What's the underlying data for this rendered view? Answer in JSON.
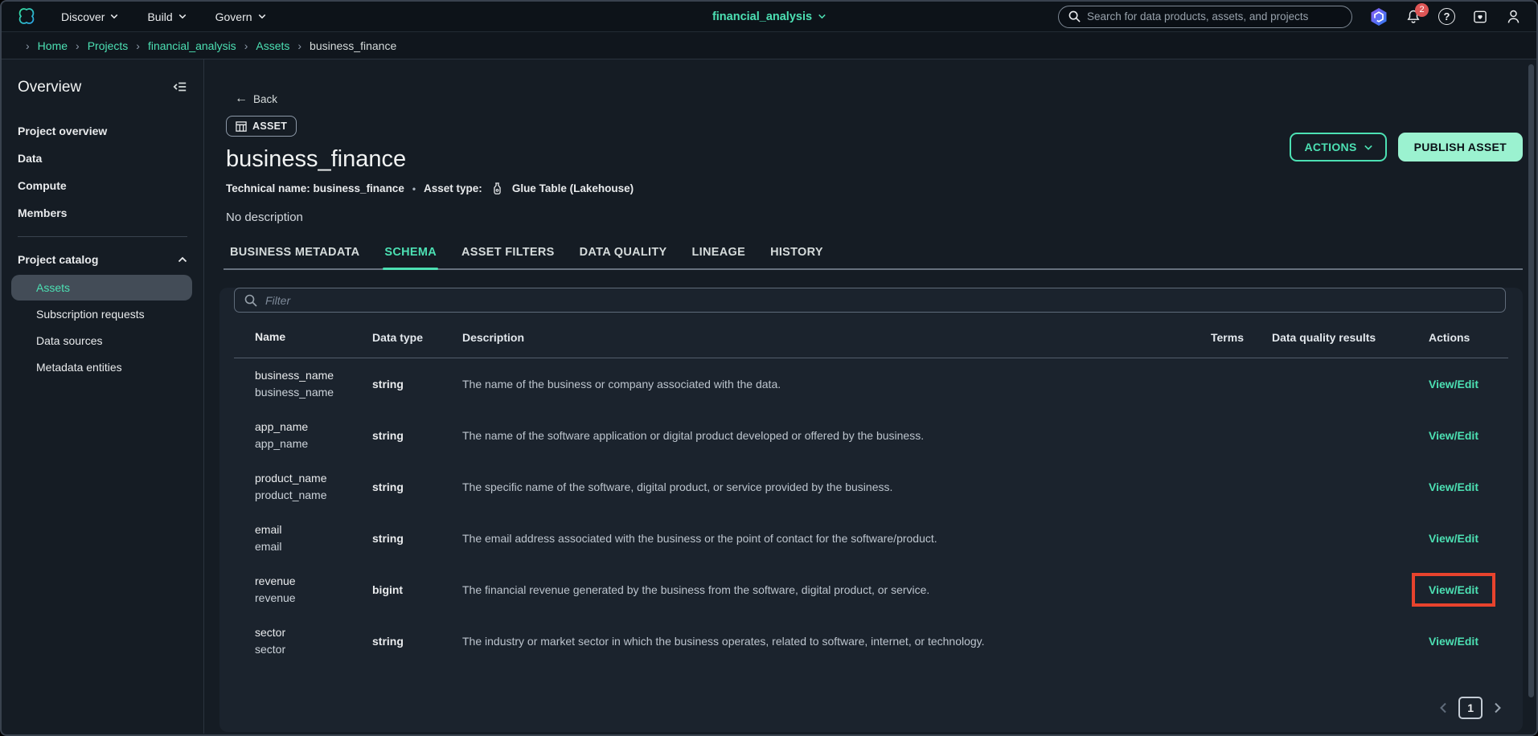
{
  "colors": {
    "accent": "#4ce0b3",
    "publish_bg": "#9bf2d0",
    "publish_text": "#0c1218",
    "highlight": "#e8432d",
    "badge": "#dd5555",
    "selected_bg": "#434c57"
  },
  "topnav": {
    "menus": [
      {
        "label": "Discover"
      },
      {
        "label": "Build"
      },
      {
        "label": "Govern"
      }
    ],
    "project_selector": "financial_analysis",
    "search_placeholder": "Search for data products, assets, and projects",
    "notification_count": "2",
    "help_glyph": "?"
  },
  "breadcrumb": {
    "separator": "›",
    "items": [
      {
        "label": "Home"
      },
      {
        "label": "Projects"
      },
      {
        "label": "financial_analysis"
      },
      {
        "label": "Assets"
      },
      {
        "label": "business_finance",
        "current": true
      }
    ]
  },
  "sidebar": {
    "title": "Overview",
    "items": [
      {
        "label": "Project overview"
      },
      {
        "label": "Data"
      },
      {
        "label": "Compute"
      },
      {
        "label": "Members"
      }
    ],
    "section": {
      "label": "Project catalog",
      "children": [
        {
          "label": "Assets",
          "selected": true
        },
        {
          "label": "Subscription requests"
        },
        {
          "label": "Data sources"
        },
        {
          "label": "Metadata entities"
        }
      ]
    }
  },
  "asset": {
    "back_arrow": "←",
    "back_label": "Back",
    "badge": "ASSET",
    "title": "business_finance",
    "technical_name": "Technical name: business_finance",
    "bullet": "•",
    "asset_type_label": "Asset type:",
    "asset_type_value": "Glue Table (Lakehouse)",
    "description": "No description",
    "actions_button": "ACTIONS",
    "publish_button": "PUBLISH ASSET"
  },
  "tabs": [
    {
      "label": "BUSINESS METADATA"
    },
    {
      "label": "SCHEMA",
      "active": true
    },
    {
      "label": "ASSET FILTERS"
    },
    {
      "label": "DATA QUALITY"
    },
    {
      "label": "LINEAGE"
    },
    {
      "label": "HISTORY"
    }
  ],
  "schema": {
    "filter_placeholder": "Filter",
    "columns": {
      "name": "Name",
      "type": "Data type",
      "description": "Description",
      "terms": "Terms",
      "quality": "Data quality results",
      "actions": "Actions"
    },
    "rows": [
      {
        "name": "business_name",
        "technical": "business_name",
        "type": "string",
        "description": "The name of the business or company associated with the data.",
        "action": "View/Edit"
      },
      {
        "name": "app_name",
        "technical": "app_name",
        "type": "string",
        "description": "The name of the software application or digital product developed or offered by the business.",
        "action": "View/Edit"
      },
      {
        "name": "product_name",
        "technical": "product_name",
        "type": "string",
        "description": "The specific name of the software, digital product, or service provided by the business.",
        "action": "View/Edit"
      },
      {
        "name": "email",
        "technical": "email",
        "type": "string",
        "description": "The email address associated with the business or the point of contact for the software/product.",
        "action": "View/Edit"
      },
      {
        "name": "revenue",
        "technical": "revenue",
        "type": "bigint",
        "description": "The financial revenue generated by the business from the software, digital product, or service.",
        "action": "View/Edit",
        "highlighted": true
      },
      {
        "name": "sector",
        "technical": "sector",
        "type": "string",
        "description": "The industry or market sector in which the business operates, related to software, internet, or technology.",
        "action": "View/Edit"
      }
    ],
    "pagination": {
      "page": "1"
    }
  }
}
